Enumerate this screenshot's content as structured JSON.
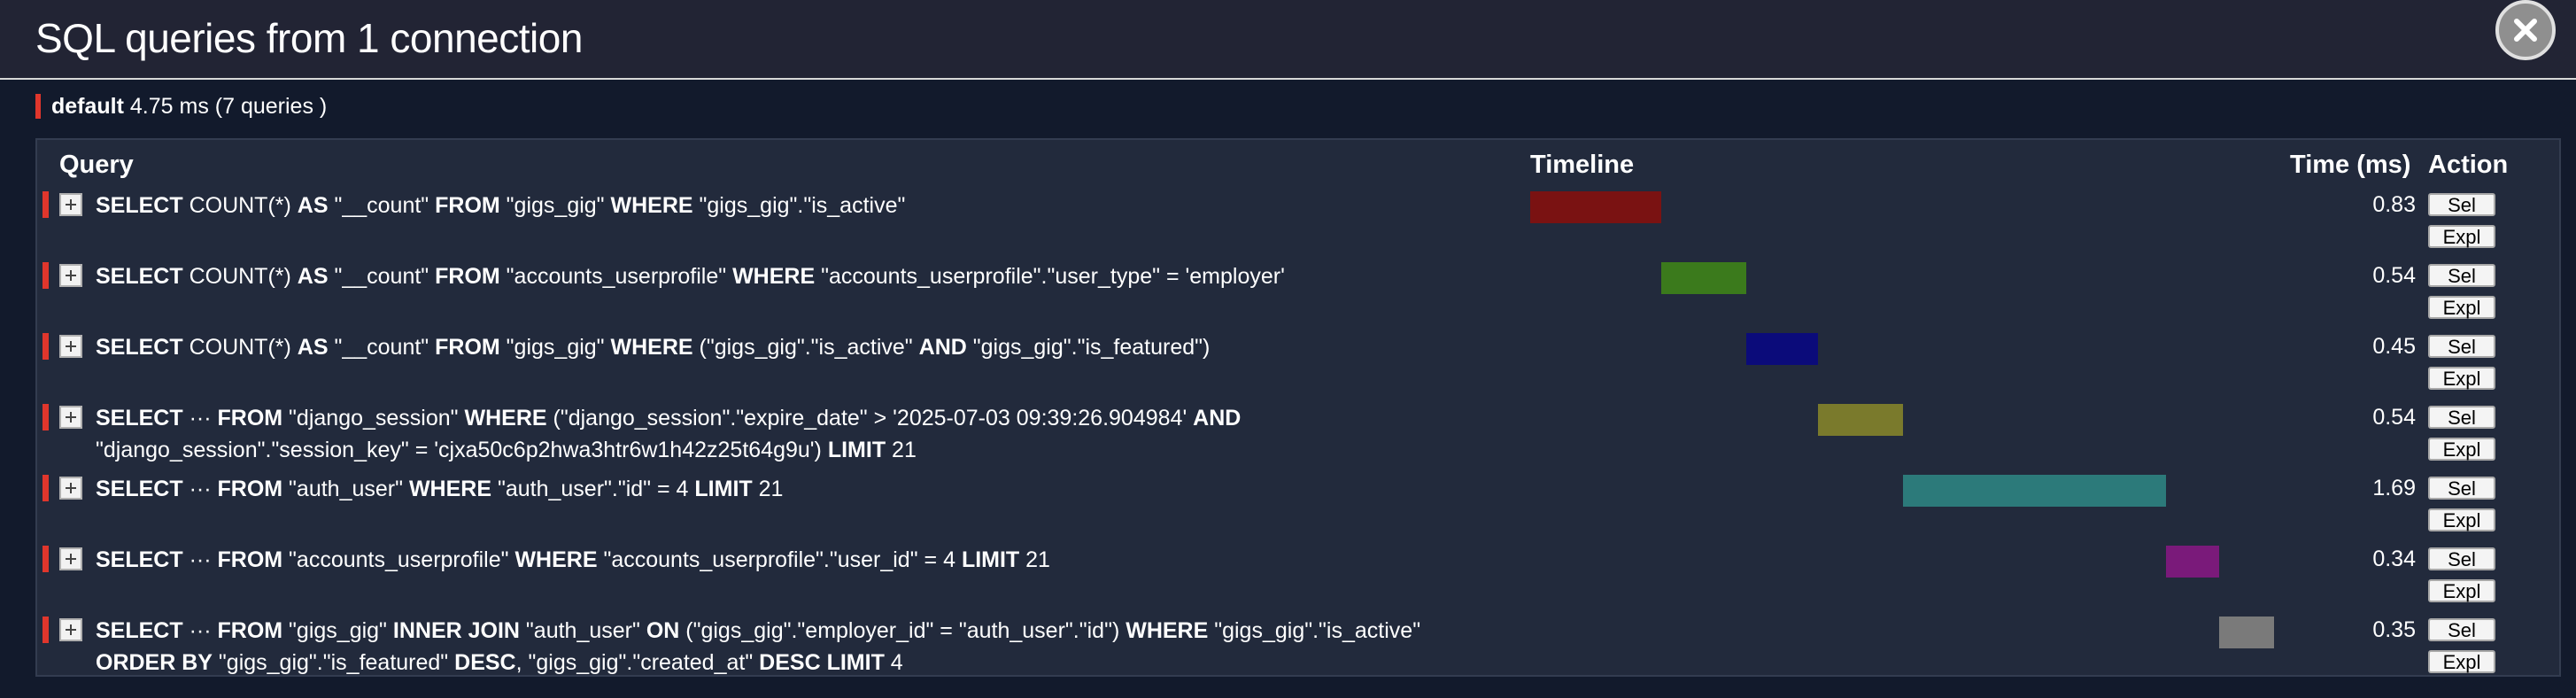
{
  "header": {
    "title": "SQL queries from 1 connection"
  },
  "summary": {
    "alias": "default",
    "stats": "4.75 ms (7 queries )"
  },
  "columns": {
    "query": "Query",
    "timeline": "Timeline",
    "time": "Time (ms)",
    "action": "Action"
  },
  "colors": {
    "accent_red": "#e0362c"
  },
  "actions": {
    "select_label": "Sel",
    "explain_label": "Expl"
  },
  "queries": [
    {
      "sql": [
        [
          "k",
          "SELECT"
        ],
        [
          "t",
          " COUNT(*) "
        ],
        [
          "k",
          "AS"
        ],
        [
          "t",
          " \"__count\" "
        ],
        [
          "k",
          "FROM"
        ],
        [
          "t",
          " \"gigs_gig\" "
        ],
        [
          "k",
          "WHERE"
        ],
        [
          "t",
          " \"gigs_gig\".\"is_active\""
        ]
      ],
      "time": "0.83",
      "timeline_start_pct": 0.0,
      "timeline_width_pct": 17.5,
      "color": "#7a1212"
    },
    {
      "sql": [
        [
          "k",
          "SELECT"
        ],
        [
          "t",
          " COUNT(*) "
        ],
        [
          "k",
          "AS"
        ],
        [
          "t",
          " \"__count\" "
        ],
        [
          "k",
          "FROM"
        ],
        [
          "t",
          " \"accounts_userprofile\" "
        ],
        [
          "k",
          "WHERE"
        ],
        [
          "t",
          " \"accounts_userprofile\".\"user_type\" = 'employer'"
        ]
      ],
      "time": "0.54",
      "timeline_start_pct": 17.5,
      "timeline_width_pct": 11.3,
      "color": "#3b7a1c"
    },
    {
      "sql": [
        [
          "k",
          "SELECT"
        ],
        [
          "t",
          " COUNT(*) "
        ],
        [
          "k",
          "AS"
        ],
        [
          "t",
          " \"__count\" "
        ],
        [
          "k",
          "FROM"
        ],
        [
          "t",
          " \"gigs_gig\" "
        ],
        [
          "k",
          "WHERE"
        ],
        [
          "t",
          " (\"gigs_gig\".\"is_active\" "
        ],
        [
          "k",
          "AND"
        ],
        [
          "t",
          " \"gigs_gig\".\"is_featured\")"
        ]
      ],
      "time": "0.45",
      "timeline_start_pct": 28.8,
      "timeline_width_pct": 9.5,
      "color": "#0b0b7a"
    },
    {
      "sql": [
        [
          "k",
          "SELECT"
        ],
        [
          "t",
          " ··· "
        ],
        [
          "k",
          "FROM"
        ],
        [
          "t",
          " \"django_session\" "
        ],
        [
          "k",
          "WHERE"
        ],
        [
          "t",
          " (\"django_session\".\"expire_date\" > '2025-07-03 09:39:26.904984' "
        ],
        [
          "k",
          "AND"
        ],
        [
          "br",
          ""
        ],
        [
          "t",
          "\"django_session\".\"session_key\" = 'cjxa50c6p2hwa3htr6w1h42z25t64g9u') "
        ],
        [
          "k",
          "LIMIT"
        ],
        [
          "t",
          " 21"
        ]
      ],
      "time": "0.54",
      "timeline_start_pct": 38.3,
      "timeline_width_pct": 11.3,
      "color": "#7a7a2c"
    },
    {
      "sql": [
        [
          "k",
          "SELECT"
        ],
        [
          "t",
          " ··· "
        ],
        [
          "k",
          "FROM"
        ],
        [
          "t",
          " \"auth_user\" "
        ],
        [
          "k",
          "WHERE"
        ],
        [
          "t",
          " \"auth_user\".\"id\" = 4 "
        ],
        [
          "k",
          "LIMIT"
        ],
        [
          "t",
          " 21"
        ]
      ],
      "time": "1.69",
      "timeline_start_pct": 49.6,
      "timeline_width_pct": 35.1,
      "color": "#2c7a7a"
    },
    {
      "sql": [
        [
          "k",
          "SELECT"
        ],
        [
          "t",
          " ··· "
        ],
        [
          "k",
          "FROM"
        ],
        [
          "t",
          " \"accounts_userprofile\" "
        ],
        [
          "k",
          "WHERE"
        ],
        [
          "t",
          " \"accounts_userprofile\".\"user_id\" = 4 "
        ],
        [
          "k",
          "LIMIT"
        ],
        [
          "t",
          " 21"
        ]
      ],
      "time": "0.34",
      "timeline_start_pct": 84.7,
      "timeline_width_pct": 7.1,
      "color": "#7a1a7a"
    },
    {
      "sql": [
        [
          "k",
          "SELECT"
        ],
        [
          "t",
          " ··· "
        ],
        [
          "k",
          "FROM"
        ],
        [
          "t",
          " \"gigs_gig\" "
        ],
        [
          "k",
          "INNER JOIN"
        ],
        [
          "t",
          " \"auth_user\" "
        ],
        [
          "k",
          "ON"
        ],
        [
          "t",
          " (\"gigs_gig\".\"employer_id\" = \"auth_user\".\"id\") "
        ],
        [
          "k",
          "WHERE"
        ],
        [
          "t",
          " \"gigs_gig\".\"is_active\""
        ],
        [
          "br",
          ""
        ],
        [
          "k",
          "ORDER BY"
        ],
        [
          "t",
          " \"gigs_gig\".\"is_featured\" "
        ],
        [
          "k",
          "DESC"
        ],
        [
          "t",
          ", \"gigs_gig\".\"created_at\" "
        ],
        [
          "k",
          "DESC"
        ],
        [
          "t",
          " "
        ],
        [
          "k",
          "LIMIT"
        ],
        [
          "t",
          " 4"
        ]
      ],
      "time": "0.35",
      "timeline_start_pct": 91.8,
      "timeline_width_pct": 7.2,
      "color": "#7a7a7a"
    }
  ]
}
